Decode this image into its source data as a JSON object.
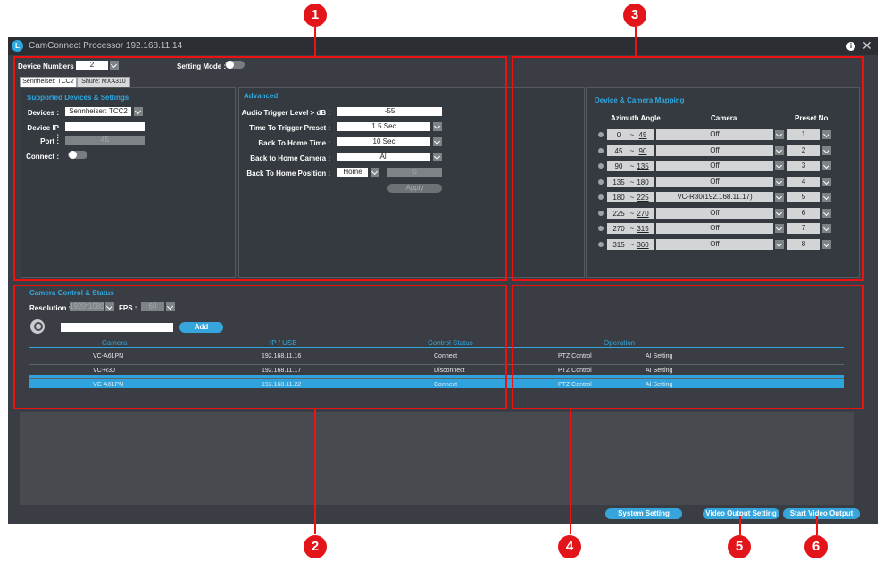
{
  "badges": [
    "1",
    "2",
    "3",
    "4",
    "5",
    "6"
  ],
  "window": {
    "title": "CamConnect Processor 192.168.11.14",
    "app_icon_glyph": "L",
    "info_icon_glyph": "i",
    "close_icon_glyph": "✕"
  },
  "top": {
    "device_numbers_label": "Device Numbers :",
    "device_numbers_value": "2",
    "setting_mode_label": "Setting Mode :"
  },
  "tabs": [
    "Sennheiser: TCC2",
    "Shure: MXA310"
  ],
  "supported": {
    "title": "Supported Devices & Settings",
    "devices_label": "Devices :",
    "devices_value": "Sennheiser: TCC2",
    "device_ip_label": "Device IP :",
    "device_ip_value": "",
    "port_label": "Port :",
    "port_value": "45",
    "connect_label": "Connect :"
  },
  "advanced": {
    "title": "Advanced",
    "audio_label": "Audio Trigger Level > dB :",
    "audio_value": "-55",
    "time_trigger_label": "Time To Trigger Preset :",
    "time_trigger_value": "1.5 Sec",
    "back_home_time_label": "Back To Home Time :",
    "back_home_time_value": "10 Sec",
    "back_home_camera_label": "Back to Home Camera :",
    "back_home_camera_value": "All",
    "back_home_position_label": "Back To Home Position :",
    "back_home_position_value": "Home",
    "back_home_position_num": "0",
    "apply_label": "Apply"
  },
  "mapping": {
    "title": "Device & Camera Mapping",
    "headers": [
      "Azimuth Angle",
      "Camera",
      "Preset No."
    ],
    "rows": [
      {
        "from": "0",
        "to": "45",
        "camera": "Off",
        "preset": "1"
      },
      {
        "from": "45",
        "to": "90",
        "camera": "Off",
        "preset": "2"
      },
      {
        "from": "90",
        "to": "135",
        "camera": "Off",
        "preset": "3"
      },
      {
        "from": "135",
        "to": "180",
        "camera": "Off",
        "preset": "4"
      },
      {
        "from": "180",
        "to": "225",
        "camera": "VC-R30(192.168.11.17)",
        "preset": "5"
      },
      {
        "from": "225",
        "to": "270",
        "camera": "Off",
        "preset": "6"
      },
      {
        "from": "270",
        "to": "315",
        "camera": "Off",
        "preset": "7"
      },
      {
        "from": "315",
        "to": "360",
        "camera": "Off",
        "preset": "8"
      }
    ],
    "sep": "~"
  },
  "camera_control": {
    "title": "Camera Control & Status",
    "resolution_label": "Resolution :",
    "resolution_value": "1920*1080",
    "fps_label": "FPS :",
    "fps_value": "60",
    "search_value": "",
    "add_label": "Add",
    "headers": [
      "Camera",
      "IP / USB",
      "Control Status",
      "Operation"
    ],
    "rows": [
      {
        "camera": "VC-A61PN",
        "ip": "192.168.11.16",
        "status": "Connect",
        "op1": "PTZ Control",
        "op2": "AI Setting"
      },
      {
        "camera": "VC-R30",
        "ip": "192.168.11.17",
        "status": "Disconnect",
        "op1": "PTZ Control",
        "op2": "AI Setting"
      },
      {
        "camera": "VC-A61PN",
        "ip": "192.168.11.22",
        "status": "Connect",
        "op1": "PTZ Control",
        "op2": "AI Setting"
      }
    ]
  },
  "footer": {
    "system_setting": "System Setting",
    "video_output_setting": "Video Output Setting",
    "start_video_output": "Start Video Output"
  }
}
